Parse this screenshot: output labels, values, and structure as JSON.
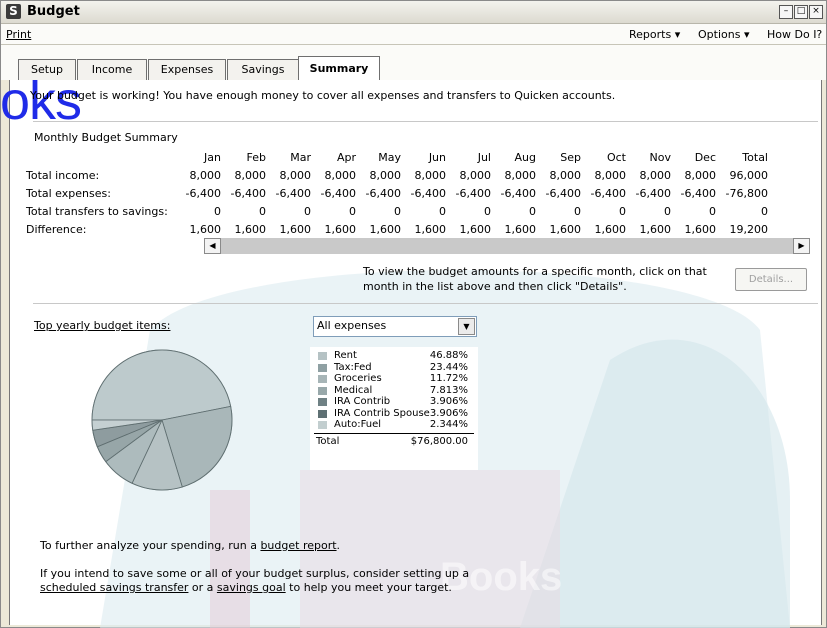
{
  "window": {
    "title": "Budget",
    "app_icon_glyph": "S"
  },
  "menubar": {
    "print": "Print",
    "reports": "Reports ▾",
    "options": "Options ▾",
    "howdoi": "How Do I?"
  },
  "tabs": [
    {
      "label": "Setup"
    },
    {
      "label": "Income"
    },
    {
      "label": "Expenses"
    },
    {
      "label": "Savings"
    },
    {
      "label": "Summary"
    }
  ],
  "status_message": "Your budget is working! You have enough money to cover all expenses and transfers to Quicken accounts.",
  "summary": {
    "title": "Monthly Budget Summary",
    "months": [
      "Jan",
      "Feb",
      "Mar",
      "Apr",
      "May",
      "Jun",
      "Jul",
      "Aug",
      "Sep",
      "Oct",
      "Nov",
      "Dec",
      "Total"
    ],
    "rows": [
      {
        "label": "Total income:",
        "values": [
          "8,000",
          "8,000",
          "8,000",
          "8,000",
          "8,000",
          "8,000",
          "8,000",
          "8,000",
          "8,000",
          "8,000",
          "8,000",
          "8,000",
          "96,000"
        ]
      },
      {
        "label": "Total expenses:",
        "values": [
          "-6,400",
          "-6,400",
          "-6,400",
          "-6,400",
          "-6,400",
          "-6,400",
          "-6,400",
          "-6,400",
          "-6,400",
          "-6,400",
          "-6,400",
          "-6,400",
          "-76,800"
        ]
      },
      {
        "label": "Total transfers to savings:",
        "values": [
          "0",
          "0",
          "0",
          "0",
          "0",
          "0",
          "0",
          "0",
          "0",
          "0",
          "0",
          "0",
          "0"
        ]
      },
      {
        "label": "Difference:",
        "values": [
          "1,600",
          "1,600",
          "1,600",
          "1,600",
          "1,600",
          "1,600",
          "1,600",
          "1,600",
          "1,600",
          "1,600",
          "1,600",
          "1,600",
          "19,200"
        ]
      }
    ]
  },
  "details": {
    "instruction": "To view the budget amounts for a specific month, click on that",
    "instruction2": "month in the list above and then click \"Details\".",
    "button": "Details..."
  },
  "top_items": {
    "label": "Top yearly budget items:",
    "selected": "All expenses"
  },
  "chart_data": {
    "type": "pie",
    "categories": [
      "Rent",
      "Tax:Fed",
      "Groceries",
      "Medical",
      "IRA Contrib",
      "IRA Contrib Spouse",
      "Auto:Fuel"
    ],
    "values": [
      46.88,
      23.44,
      11.72,
      7.813,
      3.906,
      3.906,
      2.344
    ],
    "value_labels": [
      "46.88%",
      "23.44%",
      "11.72%",
      "7.813%",
      "3.906%",
      "3.906%",
      "2.344%"
    ],
    "total_label": "Total",
    "total_value": "$76,800.00",
    "colors": [
      "#b5c2c4",
      "#8fa0a3",
      "#a7b5b7",
      "#98a8aa",
      "#6f8184",
      "#5e7073",
      "#c2cecf"
    ]
  },
  "footer": {
    "analyze_prefix": "To further analyze your spending, run a ",
    "analyze_link": "budget report",
    "analyze_suffix": ".",
    "save_line1": "If you intend to save some or all of your budget surplus, consider setting up a",
    "save_link1": "scheduled savings transfer",
    "save_mid": " or a ",
    "save_link2": "savings goal",
    "save_end": " to help you meet your target."
  },
  "overlay": {
    "brand": "oks",
    "book_text": "Books"
  }
}
